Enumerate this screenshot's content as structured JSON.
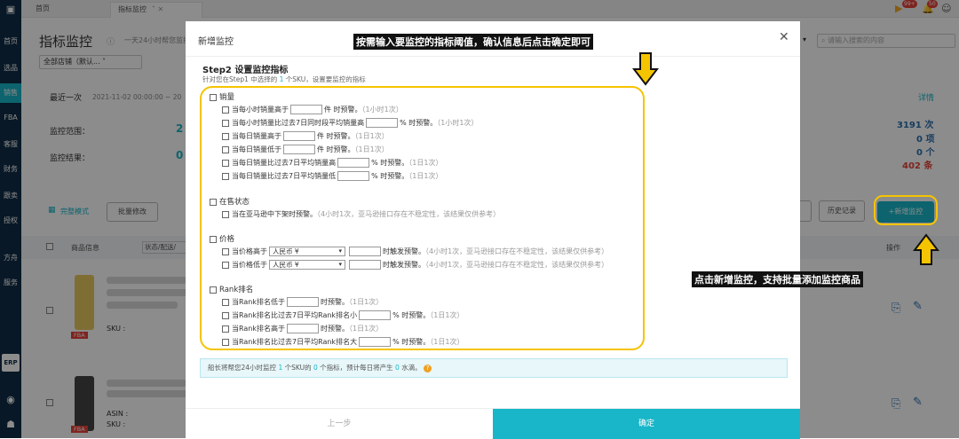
{
  "sidebar": {
    "items": [
      "首页",
      "选品",
      "销售",
      "FBA",
      "客服",
      "财务",
      "跟卖",
      "授权",
      "方舟",
      "服务"
    ],
    "erp": "ERP"
  },
  "topbar": {
    "tabs": [
      "首页",
      "指标监控"
    ],
    "badges": [
      "99+",
      "50"
    ]
  },
  "page": {
    "title": "指标监控",
    "subtitle": "一天24小时帮您监控",
    "shop_select": "全部店铺（默认...",
    "last_label": "最近一次",
    "last_time": "2021-11-02 00:00:00 ~ 20",
    "scope_label": "监控范围：",
    "scope_val": "2",
    "result_label": "监控结果：",
    "result_val": "0",
    "detail": "详情",
    "stats": [
      {
        "num": "3191",
        "unit": "次"
      },
      {
        "num": "0",
        "unit": "项"
      },
      {
        "num": "0",
        "unit": "个"
      },
      {
        "num": "402",
        "unit": "条"
      }
    ],
    "mode": "完整模式",
    "batch_edit": "批量修改",
    "history": "历史记录",
    "add_monitor": "+新增监控",
    "search_placeholder": "请输入搜索的内容",
    "col_product": "商品信息",
    "col_status": "状态/配送/",
    "col_ops": "操作",
    "sku_label": "SKU :",
    "asin_label": "ASIN :",
    "fba": "FBA"
  },
  "modal": {
    "title": "新增监控",
    "step_title": "Step2 设置监控指标",
    "step_desc_a": "针对您在Step1 中选择的 ",
    "step_desc_n": "1",
    "step_desc_b": " 个SKU，设置要监控的指标",
    "sections": [
      {
        "name": "销量",
        "rows": [
          {
            "a": "当每小时销量高于",
            "b": "件 时预警。",
            "note": "（1小时1次）"
          },
          {
            "a": "当每小时销量比过去7日同时段平均销量高",
            "b": "% 时预警。",
            "note": "（1小时1次）"
          },
          {
            "a": "当每日销量高于",
            "b": "件 时预警。",
            "note": "（1日1次）"
          },
          {
            "a": "当每日销量低于",
            "b": "件 时预警。",
            "note": "（1日1次）"
          },
          {
            "a": "当每日销量比过去7日平均销量高",
            "b": "% 时预警。",
            "note": "（1日1次）"
          },
          {
            "a": "当每日销量比过去7日平均销量低",
            "b": "% 时预警。",
            "note": "（1日1次）"
          }
        ]
      },
      {
        "name": "在售状态",
        "rows": [
          {
            "a": "当在亚马逊中下架时预警。",
            "b": "",
            "note": "（4小时1次，亚马逊接口存在不稳定性，该结果仅供参考）"
          }
        ]
      },
      {
        "name": "价格",
        "rows": [
          {
            "a": "当价格高于",
            "currency": "人民币 ¥",
            "b": "时触发预警。",
            "note": "（4小时1次，亚马逊接口存在不稳定性，该结果仅供参考）"
          },
          {
            "a": "当价格低于",
            "currency": "人民币 ¥",
            "b": "时触发预警。",
            "note": "（4小时1次，亚马逊接口存在不稳定性，该结果仅供参考）"
          }
        ]
      },
      {
        "name": "Rank排名",
        "rows": [
          {
            "a": "当Rank排名低于",
            "b": "时预警。",
            "note": "（1日1次）"
          },
          {
            "a": "当Rank排名比过去7日平均Rank排名小",
            "b": "% 时预警。",
            "note": "（1日1次）"
          },
          {
            "a": "当Rank排名高于",
            "b": "时预警。",
            "note": "（1日1次）"
          },
          {
            "a": "当Rank排名比过去7日平均Rank排名大",
            "b": "% 时预警。",
            "note": "（1日1次）"
          }
        ]
      }
    ],
    "summary": {
      "a": "船长将帮您24小时监控 ",
      "n1": "1",
      "b": " 个SKU的 ",
      "n2": "0",
      "c": " 个指标，预计每日将产生 ",
      "n3": "0",
      "d": " 水滴。"
    },
    "prev": "上一步",
    "ok": "确定"
  },
  "annotations": {
    "top": "按需输入要监控的指标阈值，确认信息后点击确定即可",
    "right": "点击新增监控，支持批量添加监控商品"
  },
  "colors": {
    "accent": "#18b6c8",
    "highlight": "#f5c400",
    "sidebar": "#0f2d45",
    "danger": "#e5423a"
  }
}
